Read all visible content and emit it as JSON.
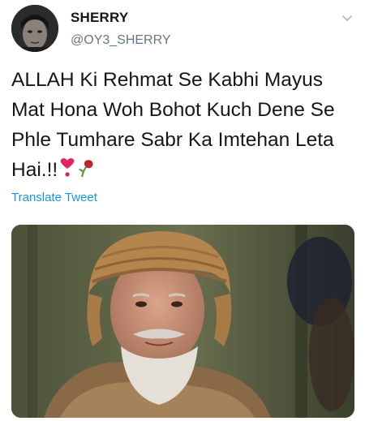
{
  "tweet": {
    "author_name": "SHERRY",
    "author_handle": "@OY3_SHERRY",
    "text": "ALLAH Ki Rehmat Se Kabhi Mayus Mat Hona Woh Bohot Kuch Dene Se  Phle Tumhare Sabr Ka Imtehan Leta Hai.!!",
    "emojis": [
      "heavy-heart-exclamation-icon",
      "wilted-rose-icon"
    ],
    "translate_label": "Translate Tweet",
    "menu_icon": "chevron-down-icon"
  },
  "colors": {
    "name": "#14171a",
    "handle": "#657786",
    "link": "#1b95e0",
    "heart": "#e0245e"
  }
}
